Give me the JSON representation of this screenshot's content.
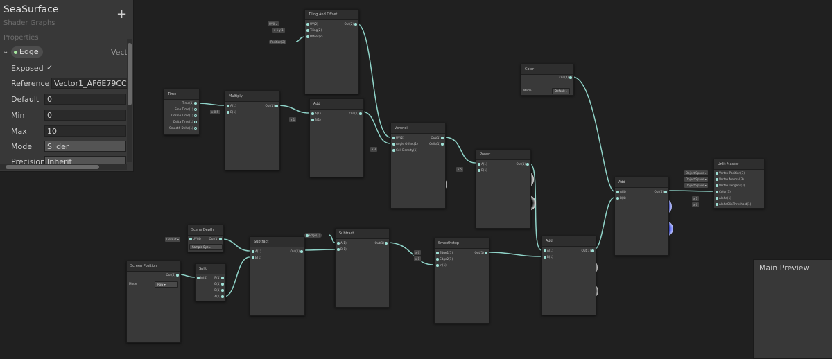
{
  "blackboard": {
    "title": "SeaSurface",
    "subtitle": "Shader Graphs",
    "add_label": "+",
    "section": "Properties",
    "property_name": "Edge",
    "property_type": "Vect",
    "exposed_label": "Exposed",
    "exposed_check": "✓",
    "reference_label": "Reference",
    "reference_value": "Vector1_AF6E79CC",
    "default_label": "Default",
    "default_value": "0",
    "min_label": "Min",
    "min_value": "0",
    "max_label": "Max",
    "max_value": "10",
    "mode_label": "Mode",
    "mode_value": "Slider",
    "precision_label": "Precision",
    "precision_value": "Inherit"
  },
  "nodes": {
    "time": {
      "title": "Time",
      "ports": [
        "Time(1)",
        "Sine Time(1)",
        "Cosine Time(1)",
        "Delta Time(1)",
        "Smooth Delta(1)"
      ]
    },
    "multiply": {
      "title": "Multiply",
      "in": [
        "A(1)",
        "B(1)"
      ],
      "out": "Out(1)",
      "pin": "0.5"
    },
    "tiling": {
      "title": "Tiling And Offset",
      "in": [
        "UV(2)",
        "Tiling(2)",
        "Offset(2)"
      ],
      "out": "Out(2)",
      "uv_pin": "UV0",
      "tx": "1",
      "ty": "1",
      "pos_pin": "Position(2)"
    },
    "add1": {
      "title": "Add",
      "in": [
        "A(1)",
        "B(1)"
      ],
      "out": "Out(1)",
      "pin": "1"
    },
    "voronoi": {
      "title": "Voronoi",
      "in": [
        "UV(2)",
        "Angle Offset(1)",
        "Cell Density(1)"
      ],
      "out": [
        "Out(1)",
        "Cells(1)"
      ],
      "pin": "3"
    },
    "power": {
      "title": "Power",
      "in": [
        "A(1)",
        "B(1)"
      ],
      "out": "Out(1)",
      "pin": "5"
    },
    "color": {
      "title": "Color",
      "out": "Out(4)",
      "mode_label": "Mode",
      "mode_value": "Default"
    },
    "add_final": {
      "title": "Add",
      "in": [
        "A(4)",
        "B(4)"
      ],
      "out": "Out(4)"
    },
    "unlit": {
      "title": "Unlit Master",
      "ports": [
        "Vertex Position(3)",
        "Vertex Normal(3)",
        "Vertex Tangent(3)",
        "Color(3)",
        "Alpha(1)",
        "AlphaClipThreshold(1)"
      ],
      "space_pin": "Object Space",
      "alpha": "1",
      "clip": "0"
    },
    "scene_depth": {
      "title": "Scene Depth",
      "in": "UV(4)",
      "out": "Out(1)",
      "pin": "Default",
      "mode": "Sample Eye"
    },
    "screen_pos": {
      "title": "Screen Position",
      "out": "Out(4)",
      "mode_label": "Mode",
      "mode_value": "Raw"
    },
    "split": {
      "title": "Split",
      "in": "In(4)",
      "out": [
        "R(1)",
        "G(1)",
        "B(1)",
        "A(1)"
      ]
    },
    "subtract1": {
      "title": "Subtract",
      "in": [
        "A(1)",
        "B(1)"
      ],
      "out": "Out(1)"
    },
    "subtract2": {
      "title": "Subtract",
      "in": [
        "A(1)",
        "B(1)"
      ],
      "out": "Out(1)",
      "edge_pin": "Edge(1)"
    },
    "smoothstep": {
      "title": "Smoothstep",
      "in": [
        "Edge1(1)",
        "Edge2(1)",
        "In(1)"
      ],
      "out": "Out(1)",
      "e1": "0",
      "e2": "1"
    },
    "add2": {
      "title": "Add",
      "in": [
        "A(1)",
        "B(1)"
      ],
      "out": "Out(1)"
    }
  },
  "main_preview": {
    "title": "Main Preview"
  },
  "colors": {
    "wire": "#8fd3c8",
    "accent": "#4655e8",
    "graph_bg": "#202020"
  }
}
